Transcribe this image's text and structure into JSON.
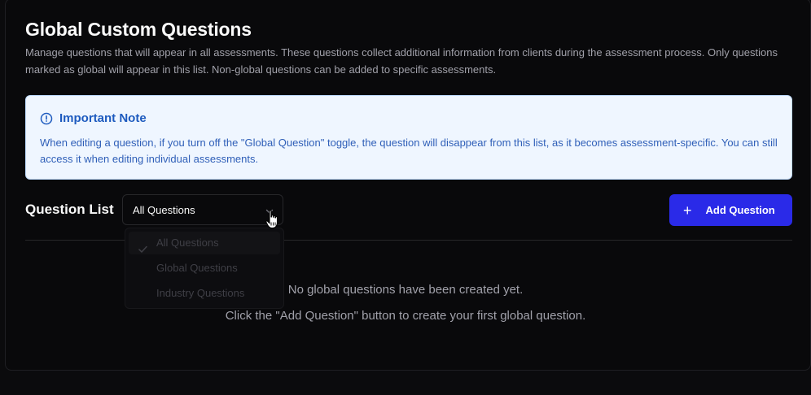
{
  "header": {
    "title": "Global Custom Questions",
    "description": "Manage questions that will appear in all assessments. These questions collect additional information from clients during the assessment process. Only questions marked as global will appear in this list. Non-global questions can be added to specific assessments."
  },
  "note": {
    "icon": "info-circle-icon",
    "title": "Important Note",
    "body": "When editing a question, if you turn off the \"Global Question\" toggle, the question will disappear from this list, as it becomes assessment-specific. You can still access it when editing individual assessments.",
    "colors": {
      "background": "#eff6ff",
      "border": "#bfdbfe",
      "text": "#1e5bbf"
    }
  },
  "question_list": {
    "title": "Question List",
    "filter": {
      "selected": "All Questions",
      "options": [
        "All Questions",
        "Global Questions",
        "Industry Questions"
      ]
    },
    "add_button": {
      "icon": "plus-icon",
      "label": "Add Question",
      "color": "#2a2ae8"
    },
    "empty_state": {
      "line1": "No global questions have been created yet.",
      "line2": "Click the \"Add Question\" button to create your first global question."
    }
  }
}
